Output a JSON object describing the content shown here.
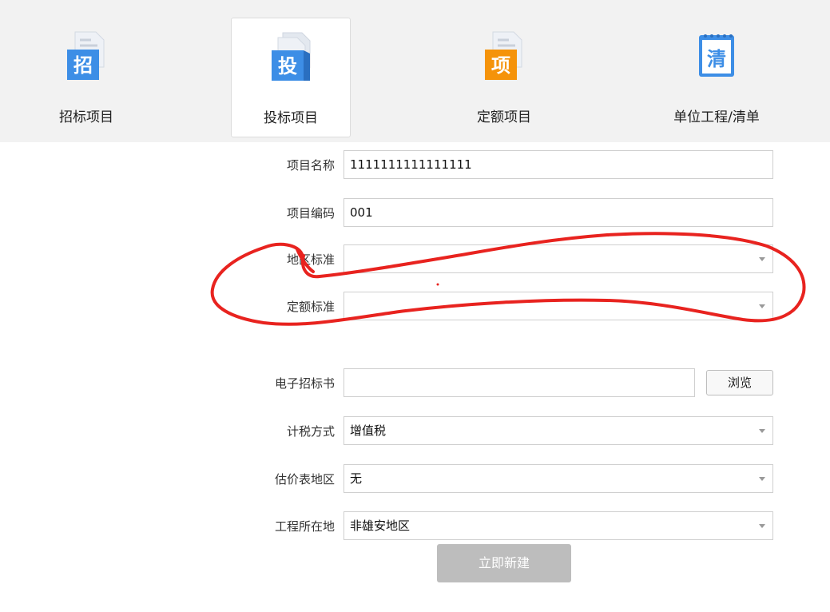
{
  "tabs": [
    {
      "label": "招标项目",
      "icon_glyph": "招",
      "icon_color": "#3d8ee6",
      "icon": "tender-doc-icon"
    },
    {
      "label": "投标项目",
      "icon_glyph": "投",
      "icon_color": "#3d8ee6",
      "icon": "bid-doc-icon",
      "active": true
    },
    {
      "label": "定额项目",
      "icon_glyph": "项",
      "icon_color": "#f5930a",
      "icon": "quota-doc-icon"
    },
    {
      "label": "单位工程/清单",
      "icon_glyph": "清",
      "icon_color": "#3d8ee6",
      "icon": "list-clipboard-icon"
    }
  ],
  "form": {
    "project_name": {
      "label": "项目名称",
      "value": "1111111111111111"
    },
    "project_code": {
      "label": "项目编码",
      "value": "001"
    },
    "region_standard": {
      "label": "地区标准",
      "value": ""
    },
    "quota_standard": {
      "label": "定额标准",
      "value": ""
    },
    "e_tender_file": {
      "label": "电子招标书",
      "value": "",
      "browse_label": "浏览"
    },
    "tax_method": {
      "label": "计税方式",
      "value": "增值税"
    },
    "estimate_region": {
      "label": "估价表地区",
      "value": "无"
    },
    "project_location": {
      "label": "工程所在地",
      "value": "非雄安地区"
    }
  },
  "submit_label": "立即新建",
  "colors": {
    "annotation": "#e8231f",
    "accent_blue": "#3d8ee6",
    "accent_orange": "#f5930a",
    "button_disabled": "#bdbdbd"
  }
}
